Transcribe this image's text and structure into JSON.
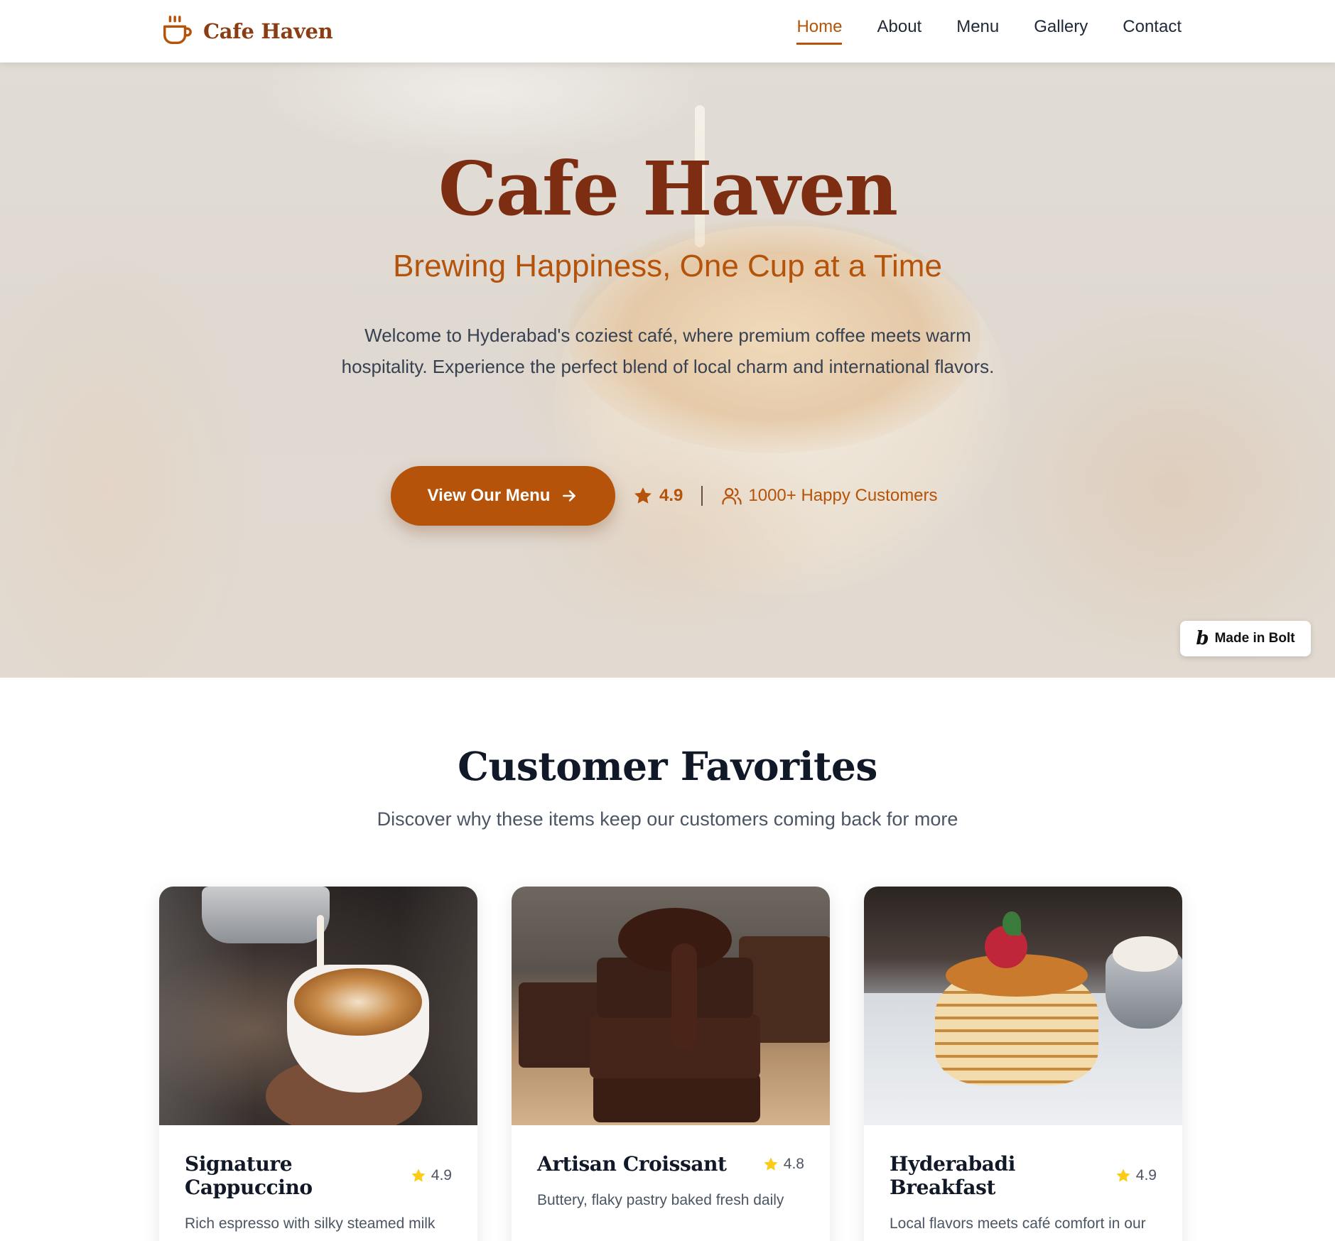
{
  "nav": {
    "brand": "Cafe Haven",
    "brand_icon": "coffee-cup-icon",
    "links": [
      {
        "label": "Home",
        "active": true
      },
      {
        "label": "About",
        "active": false
      },
      {
        "label": "Menu",
        "active": false
      },
      {
        "label": "Gallery",
        "active": false
      },
      {
        "label": "Contact",
        "active": false
      }
    ]
  },
  "hero": {
    "title": "Cafe Haven",
    "tagline": "Brewing Happiness, One Cup at a Time",
    "description": "Welcome to Hyderabad's coziest café, where premium coffee meets warm hospitality. Experience the perfect blend of local charm and international flavors.",
    "cta_label": "View Our Menu",
    "cta_icon": "arrow-right-icon",
    "rating": "4.9",
    "rating_icon": "star-icon",
    "customers": "1000+ Happy Customers",
    "customers_icon": "users-icon"
  },
  "badge": {
    "label": "Made in Bolt",
    "icon": "bolt-logo-icon"
  },
  "favorites": {
    "title": "Customer Favorites",
    "subtitle": "Discover why these items keep our customers coming back for more",
    "items": [
      {
        "name": "Signature Cappuccino",
        "rating": "4.9",
        "description": "Rich espresso with silky steamed milk and perfect foam art"
      },
      {
        "name": "Artisan Croissant",
        "rating": "4.8",
        "description": "Buttery, flaky pastry baked fresh daily"
      },
      {
        "name": "Hyderabadi Breakfast",
        "rating": "4.9",
        "description": "Local flavors meets café comfort in our signature breakfast"
      }
    ]
  },
  "colors": {
    "brand": "#8a3d12",
    "accent": "#b45309",
    "hero_title": "#7c2d12",
    "star": "#facc15"
  }
}
